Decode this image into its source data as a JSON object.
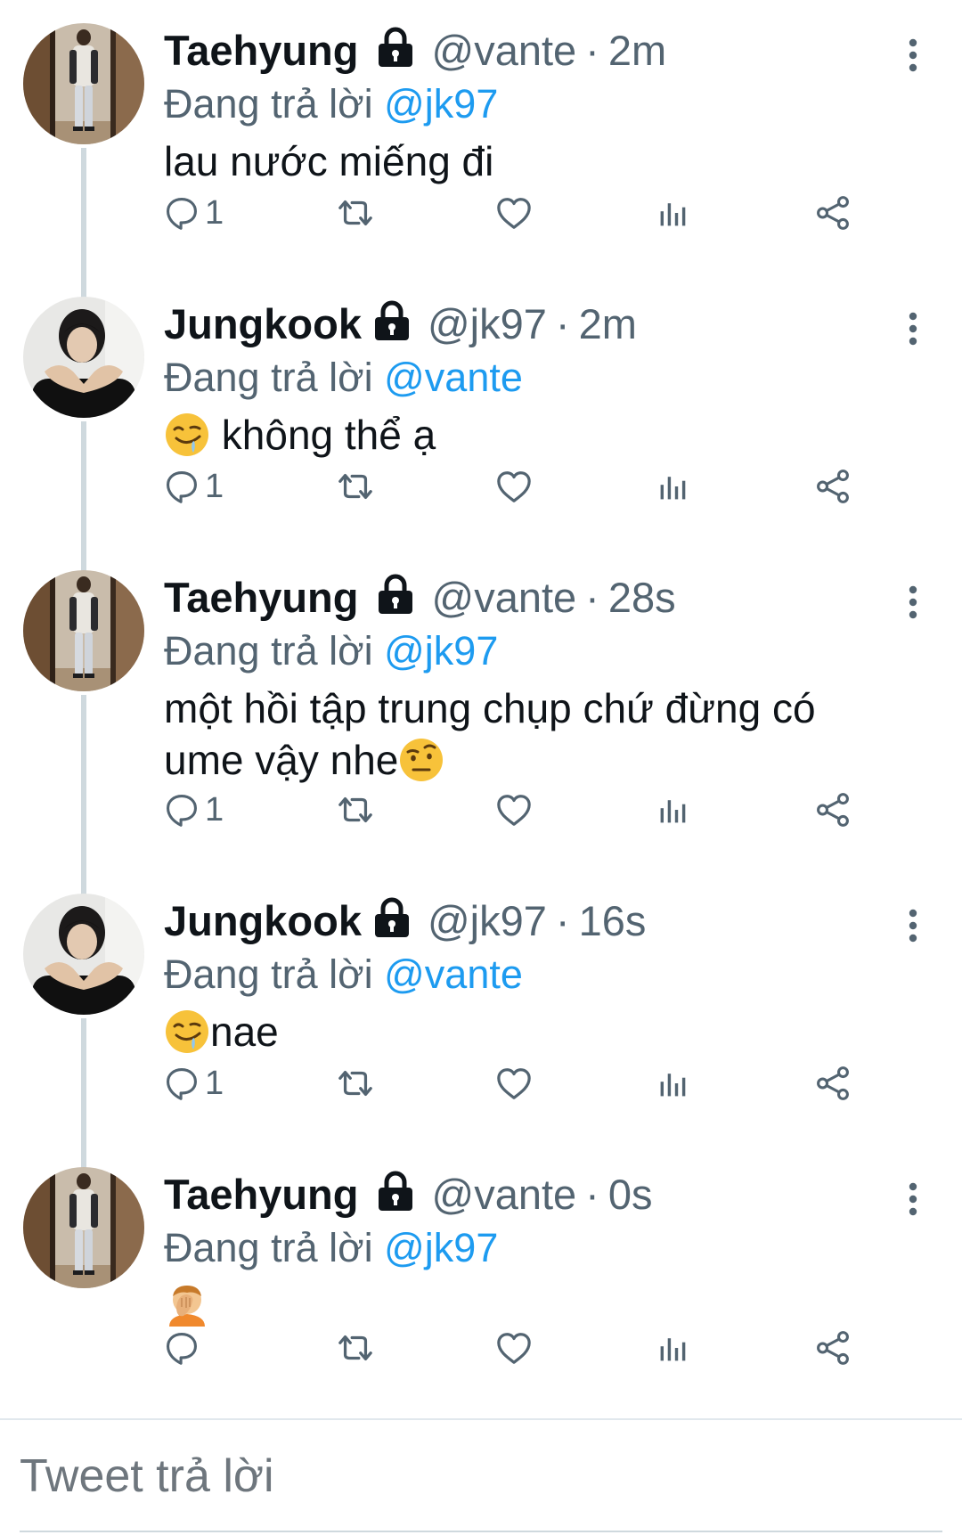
{
  "reply_prefix": "Đang trả lời",
  "tweets": [
    {
      "display_name": "Taehyung",
      "handle": "@vante",
      "separator": "·",
      "time": "2m",
      "reply_to": "@jk97",
      "text": "lau nước miếng đi",
      "reply_count": "1",
      "avatar": "taehyung-photo"
    },
    {
      "display_name": "Jungkook",
      "handle": "@jk97",
      "separator": "·",
      "time": "2m",
      "reply_to": "@vante",
      "text": "không thể ạ",
      "emoji": "drooling-face",
      "reply_count": "1",
      "avatar": "jungkook-photo"
    },
    {
      "display_name": "Taehyung",
      "handle": "@vante",
      "separator": "·",
      "time": "28s",
      "reply_to": "@jk97",
      "text_line1": "một hồi tập trung chụp chứ đừng có",
      "text_line2": "ume vậy nhe",
      "emoji": "face-with-raised-eyebrow",
      "reply_count": "1",
      "avatar": "taehyung-photo"
    },
    {
      "display_name": "Jungkook",
      "handle": "@jk97",
      "separator": "·",
      "time": "16s",
      "reply_to": "@vante",
      "text": "nae",
      "emoji": "drooling-face",
      "reply_count": "1",
      "avatar": "jungkook-photo"
    },
    {
      "display_name": "Taehyung",
      "handle": "@vante",
      "separator": "·",
      "time": "0s",
      "reply_to": "@jk97",
      "emoji": "person-facepalming",
      "reply_count": "",
      "avatar": "taehyung-photo"
    }
  ],
  "compose": {
    "placeholder": "Tweet trả lời"
  },
  "icons": {
    "reply": "reply-icon",
    "retweet": "retweet-icon",
    "like": "heart-icon",
    "views": "views-icon",
    "share": "share-icon",
    "more": "more-vertical-icon",
    "protected": "lock-icon"
  },
  "colors": {
    "mention": "#1d9bf0",
    "secondary_text": "#536471",
    "thread_line": "#cfd9de"
  }
}
